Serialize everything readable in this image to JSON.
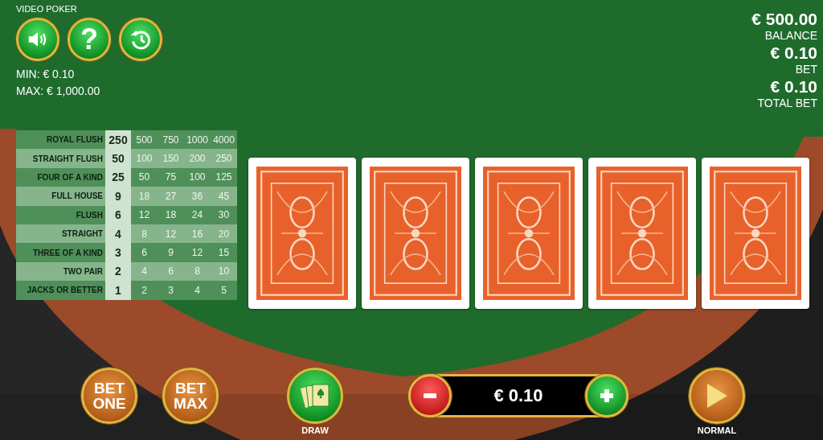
{
  "game_title": "VIDEO POKER",
  "help_button": {
    "label": "?"
  },
  "limits": {
    "min": "MIN: € 0.10",
    "max": "MAX: € 1,000.00"
  },
  "wallet": [
    {
      "value": "€ 500.00",
      "label": "BALANCE"
    },
    {
      "value": "€ 0.10",
      "label": "BET"
    },
    {
      "value": "€ 0.10",
      "label": "TOTAL BET"
    }
  ],
  "paytable": [
    {
      "hand": "ROYAL FLUSH",
      "payouts": [
        {
          "value": "250",
          "selected": true
        },
        {
          "value": "500",
          "selected": false
        },
        {
          "value": "750",
          "selected": false
        },
        {
          "value": "1000",
          "selected": false
        },
        {
          "value": "4000",
          "selected": false
        }
      ]
    },
    {
      "hand": "STRAIGHT FLUSH",
      "payouts": [
        {
          "value": "50",
          "selected": true
        },
        {
          "value": "100",
          "selected": false
        },
        {
          "value": "150",
          "selected": false
        },
        {
          "value": "200",
          "selected": false
        },
        {
          "value": "250",
          "selected": false
        }
      ]
    },
    {
      "hand": "FOUR OF A KIND",
      "payouts": [
        {
          "value": "25",
          "selected": true
        },
        {
          "value": "50",
          "selected": false
        },
        {
          "value": "75",
          "selected": false
        },
        {
          "value": "100",
          "selected": false
        },
        {
          "value": "125",
          "selected": false
        }
      ]
    },
    {
      "hand": "FULL HOUSE",
      "payouts": [
        {
          "value": "9",
          "selected": true
        },
        {
          "value": "18",
          "selected": false
        },
        {
          "value": "27",
          "selected": false
        },
        {
          "value": "36",
          "selected": false
        },
        {
          "value": "45",
          "selected": false
        }
      ]
    },
    {
      "hand": "FLUSH",
      "payouts": [
        {
          "value": "6",
          "selected": true
        },
        {
          "value": "12",
          "selected": false
        },
        {
          "value": "18",
          "selected": false
        },
        {
          "value": "24",
          "selected": false
        },
        {
          "value": "30",
          "selected": false
        }
      ]
    },
    {
      "hand": "STRAIGHT",
      "payouts": [
        {
          "value": "4",
          "selected": true
        },
        {
          "value": "8",
          "selected": false
        },
        {
          "value": "12",
          "selected": false
        },
        {
          "value": "16",
          "selected": false
        },
        {
          "value": "20",
          "selected": false
        }
      ]
    },
    {
      "hand": "THREE OF A KIND",
      "payouts": [
        {
          "value": "3",
          "selected": true
        },
        {
          "value": "6",
          "selected": false
        },
        {
          "value": "9",
          "selected": false
        },
        {
          "value": "12",
          "selected": false
        },
        {
          "value": "15",
          "selected": false
        }
      ]
    },
    {
      "hand": "TWO PAIR",
      "payouts": [
        {
          "value": "2",
          "selected": true
        },
        {
          "value": "4",
          "selected": false
        },
        {
          "value": "6",
          "selected": false
        },
        {
          "value": "8",
          "selected": false
        },
        {
          "value": "10",
          "selected": false
        }
      ]
    },
    {
      "hand": "JACKS OR BETTER",
      "payouts": [
        {
          "value": "1",
          "selected": true
        },
        {
          "value": "2",
          "selected": false
        },
        {
          "value": "3",
          "selected": false
        },
        {
          "value": "4",
          "selected": false
        },
        {
          "value": "5",
          "selected": false
        }
      ]
    }
  ],
  "cards": [
    {
      "kind": "back"
    },
    {
      "kind": "back"
    },
    {
      "kind": "back"
    },
    {
      "kind": "back"
    },
    {
      "kind": "back"
    }
  ],
  "controls": {
    "bet_one": "BET ONE",
    "bet_max": "BET MAX",
    "draw": "DRAW",
    "stake": "€ 0.10",
    "speed": "NORMAL"
  }
}
